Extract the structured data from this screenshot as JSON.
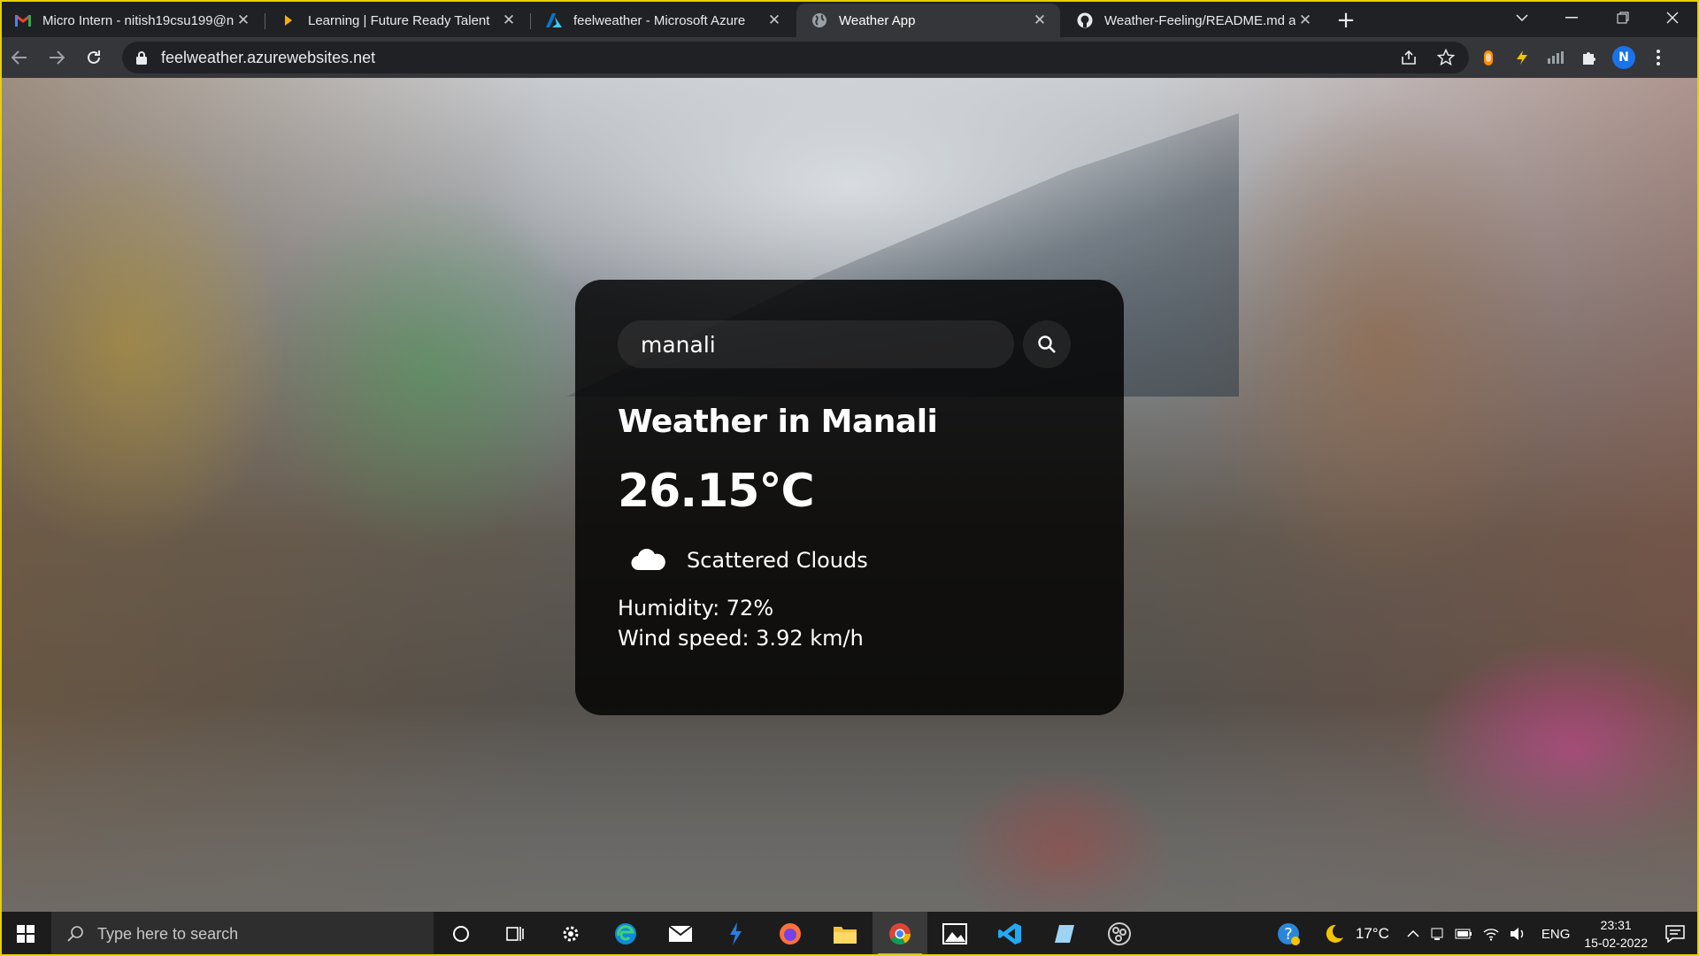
{
  "browser": {
    "tabs": [
      {
        "title": "Micro Intern - nitish19csu199@n",
        "icon": "gmail-icon",
        "active": false
      },
      {
        "title": "Learning | Future Ready Talent",
        "icon": "learning-icon",
        "active": false
      },
      {
        "title": "feelweather - Microsoft Azure",
        "icon": "azure-icon",
        "active": false
      },
      {
        "title": "Weather App",
        "icon": "globe-icon",
        "active": true
      },
      {
        "title": "Weather-Feeling/README.md at",
        "icon": "github-icon",
        "active": false
      }
    ],
    "url": "feelweather.azurewebsites.net",
    "profile_initial": "N"
  },
  "weather": {
    "search_value": "manali",
    "city_heading": "Weather in Manali",
    "temperature": "26.15°C",
    "description": "Scattered Clouds",
    "humidity": "Humidity: 72%",
    "wind": "Wind speed: 3.92 km/h",
    "icon": "cloud-icon"
  },
  "taskbar": {
    "search_placeholder": "Type here to search",
    "weather_temp": "17°C",
    "language": "ENG",
    "time": "23:31",
    "date": "15-02-2022"
  },
  "colors": {
    "card_bg": "#000000",
    "accent_blue": "#1a73e8",
    "highlight_frame": "#e8d000"
  }
}
